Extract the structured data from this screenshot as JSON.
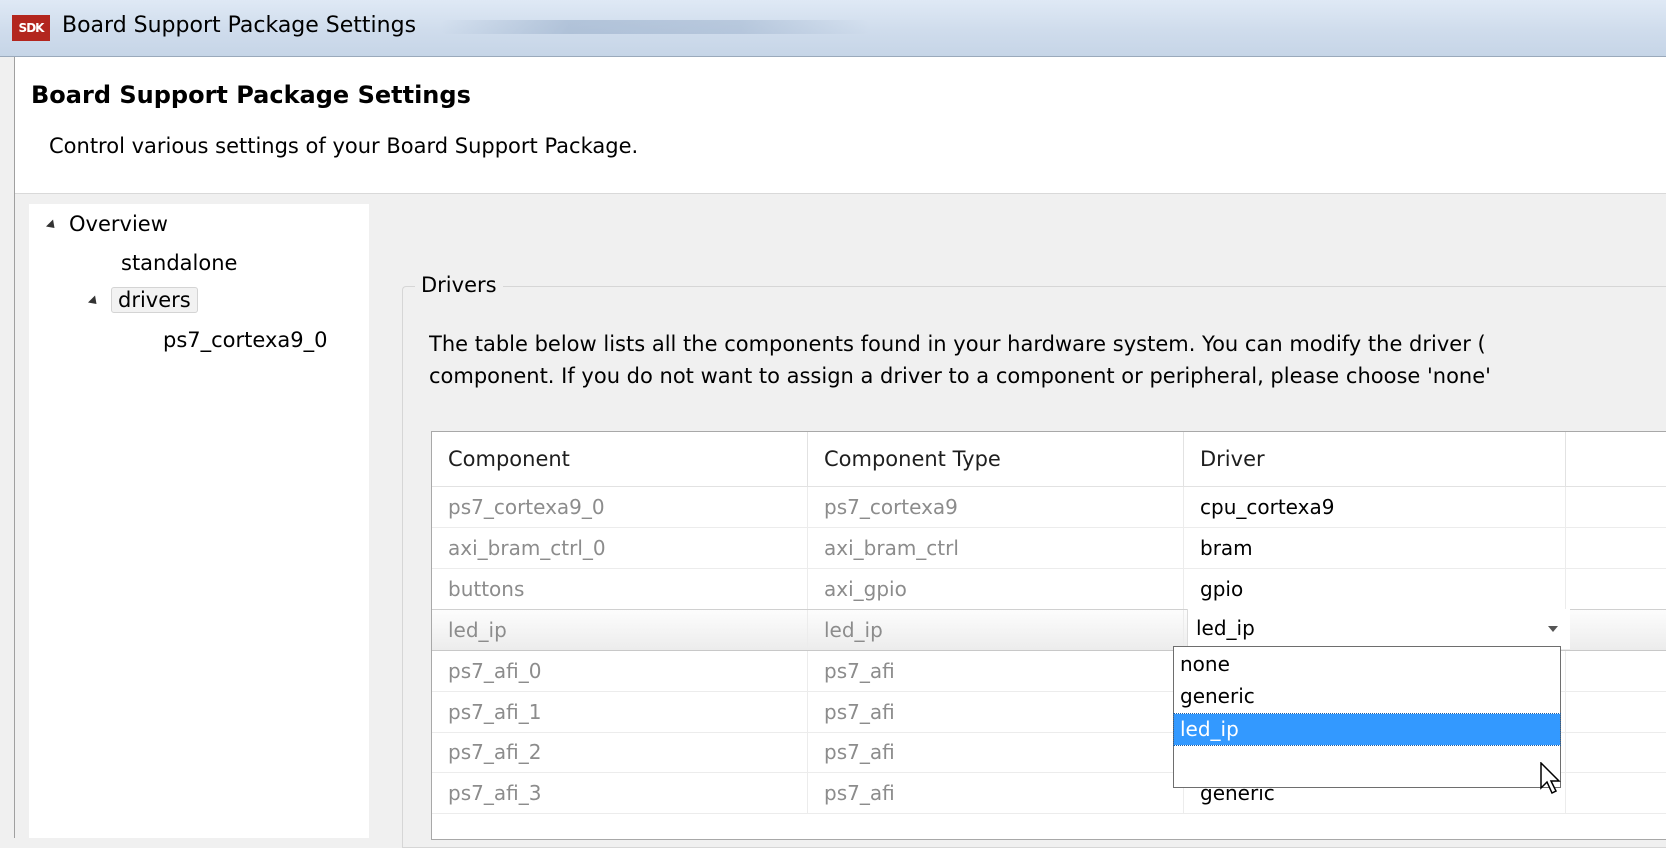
{
  "window": {
    "icon_text": "SDK",
    "title": "Board Support Package Settings"
  },
  "header": {
    "title": "Board Support Package Settings",
    "description": "Control various settings of your Board Support Package."
  },
  "tree": {
    "items": [
      {
        "label": "Overview"
      },
      {
        "label": "standalone"
      },
      {
        "label": "drivers"
      },
      {
        "label": "ps7_cortexa9_0"
      }
    ]
  },
  "drivers": {
    "group_label": "Drivers",
    "desc_line1": "The table below lists all the components found in your hardware system. You can modify the driver (",
    "desc_line2": "component. If you do not want to assign a driver to a component or peripheral, please choose 'none'",
    "columns": [
      "Component",
      "Component Type",
      "Driver"
    ],
    "rows": [
      {
        "component": "ps7_cortexa9_0",
        "type": "ps7_cortexa9",
        "driver": "cpu_cortexa9"
      },
      {
        "component": "axi_bram_ctrl_0",
        "type": "axi_bram_ctrl",
        "driver": "bram"
      },
      {
        "component": "buttons",
        "type": "axi_gpio",
        "driver": "gpio"
      },
      {
        "component": "led_ip",
        "type": "led_ip",
        "driver": "led_ip"
      },
      {
        "component": "ps7_afi_0",
        "type": "ps7_afi",
        "driver": ""
      },
      {
        "component": "ps7_afi_1",
        "type": "ps7_afi",
        "driver": ""
      },
      {
        "component": "ps7_afi_2",
        "type": "ps7_afi",
        "driver": ""
      },
      {
        "component": "ps7_afi_3",
        "type": "ps7_afi",
        "driver": "generic"
      }
    ],
    "dropdown_options": [
      "none",
      "generic",
      "led_ip"
    ],
    "dropdown_selected": "led_ip"
  },
  "colors": {
    "selection_blue": "#3399ff",
    "sdk_icon_red": "#b3261e",
    "dim_text": "#8c8c8c"
  }
}
